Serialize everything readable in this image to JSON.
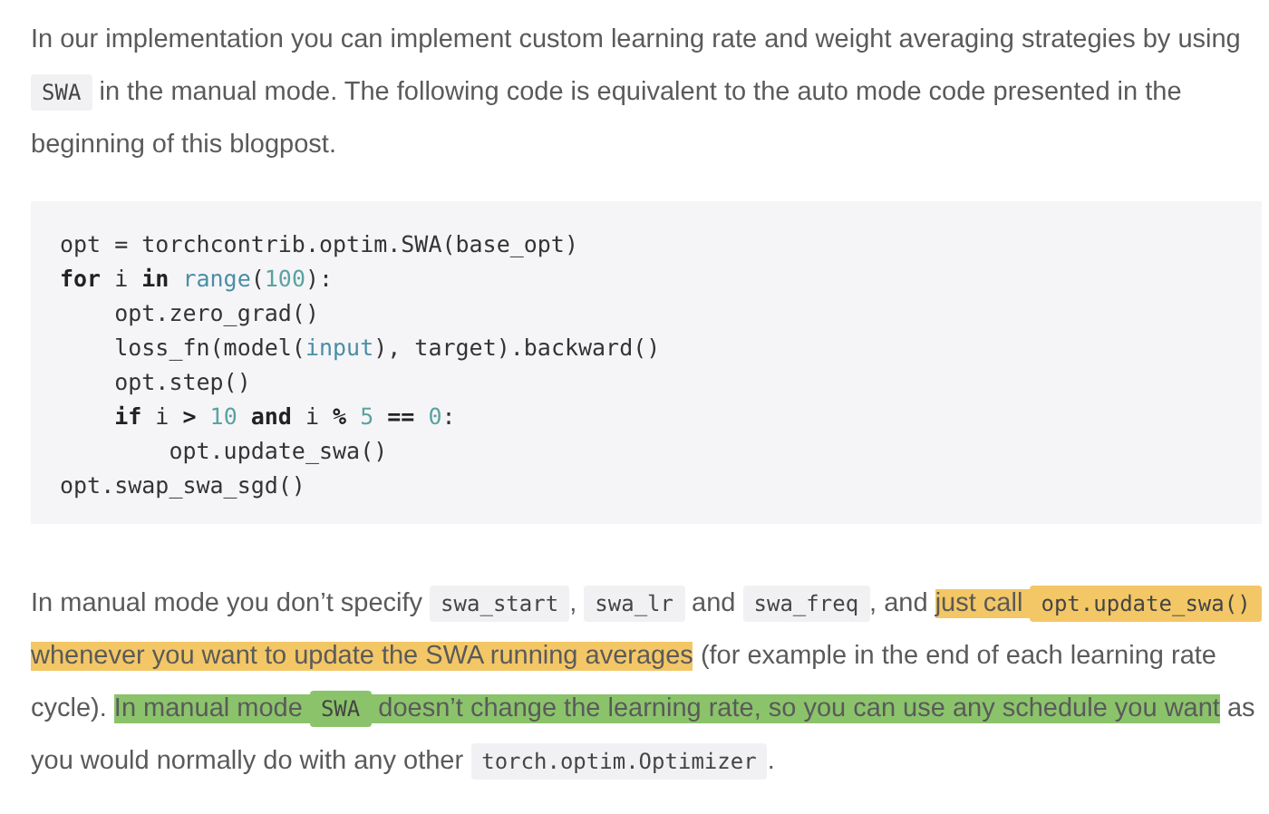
{
  "paragraphs": [
    {
      "segments": [
        {
          "kind": "text",
          "text": "In our implementation you can implement custom learning rate and weight averaging strategies by using "
        },
        {
          "kind": "code",
          "text": "SWA"
        },
        {
          "kind": "text",
          "text": " in the manual mode. The following code is equivalent to the auto mode code presented in the beginning of this blogpost."
        }
      ]
    }
  ],
  "code_block": {
    "lines": [
      [
        {
          "kind": "plain",
          "text": "opt = torchcontrib.optim.SWA(base_opt)"
        }
      ],
      [
        {
          "kind": "keyword",
          "text": "for"
        },
        {
          "kind": "plain",
          "text": " i "
        },
        {
          "kind": "keyword",
          "text": "in "
        },
        {
          "kind": "builtin",
          "text": "range"
        },
        {
          "kind": "plain",
          "text": "("
        },
        {
          "kind": "number",
          "text": "100"
        },
        {
          "kind": "plain",
          "text": "):"
        }
      ],
      [
        {
          "kind": "plain",
          "text": "    opt.zero_grad()"
        }
      ],
      [
        {
          "kind": "plain",
          "text": "    loss_fn(model("
        },
        {
          "kind": "builtin",
          "text": "input"
        },
        {
          "kind": "plain",
          "text": "), target).backward()"
        }
      ],
      [
        {
          "kind": "plain",
          "text": "    opt.step()"
        }
      ],
      [
        {
          "kind": "keyword",
          "text": "    if"
        },
        {
          "kind": "plain",
          "text": " i "
        },
        {
          "kind": "keyword",
          "text": "> "
        },
        {
          "kind": "number",
          "text": "10 "
        },
        {
          "kind": "keyword",
          "text": "and"
        },
        {
          "kind": "plain",
          "text": " i "
        },
        {
          "kind": "keyword",
          "text": "% "
        },
        {
          "kind": "number",
          "text": "5 "
        },
        {
          "kind": "keyword",
          "text": "== "
        },
        {
          "kind": "number",
          "text": "0"
        },
        {
          "kind": "plain",
          "text": ":"
        }
      ],
      [
        {
          "kind": "plain",
          "text": "        opt.update_swa()"
        }
      ],
      [
        {
          "kind": "plain",
          "text": "opt.swap_swa_sgd()"
        }
      ]
    ]
  },
  "paragraphs_after": [
    {
      "segments": [
        {
          "kind": "text",
          "text": "In manual mode you don’t specify "
        },
        {
          "kind": "code",
          "text": "swa_start"
        },
        {
          "kind": "text",
          "text": ", "
        },
        {
          "kind": "code",
          "text": "swa_lr"
        },
        {
          "kind": "text",
          "text": " and "
        },
        {
          "kind": "code",
          "text": "swa_freq"
        },
        {
          "kind": "text",
          "text": ", and "
        },
        {
          "kind": "text",
          "text": "just call ",
          "color": "#f3c766"
        },
        {
          "kind": "code",
          "text": "opt.update_swa()",
          "color": "#f3c766"
        },
        {
          "kind": "text",
          "text": " whenever you want to update the SWA running averages",
          "color": "#f3c766"
        },
        {
          "kind": "text",
          "text": " (for example in the end of each learning rate cycle). "
        },
        {
          "kind": "text",
          "text": "In manual mode ",
          "color": "#8bc36b"
        },
        {
          "kind": "code",
          "text": "SWA",
          "color": "#8bc36b"
        },
        {
          "kind": "text",
          "text": " doesn’t change the learning rate, so you can use any schedule you want",
          "color": "#8bc36b"
        },
        {
          "kind": "text",
          "text": " as you would normally do with any other "
        },
        {
          "kind": "code",
          "text": "torch.optim.Optimizer"
        },
        {
          "kind": "text",
          "text": "."
        }
      ]
    }
  ]
}
